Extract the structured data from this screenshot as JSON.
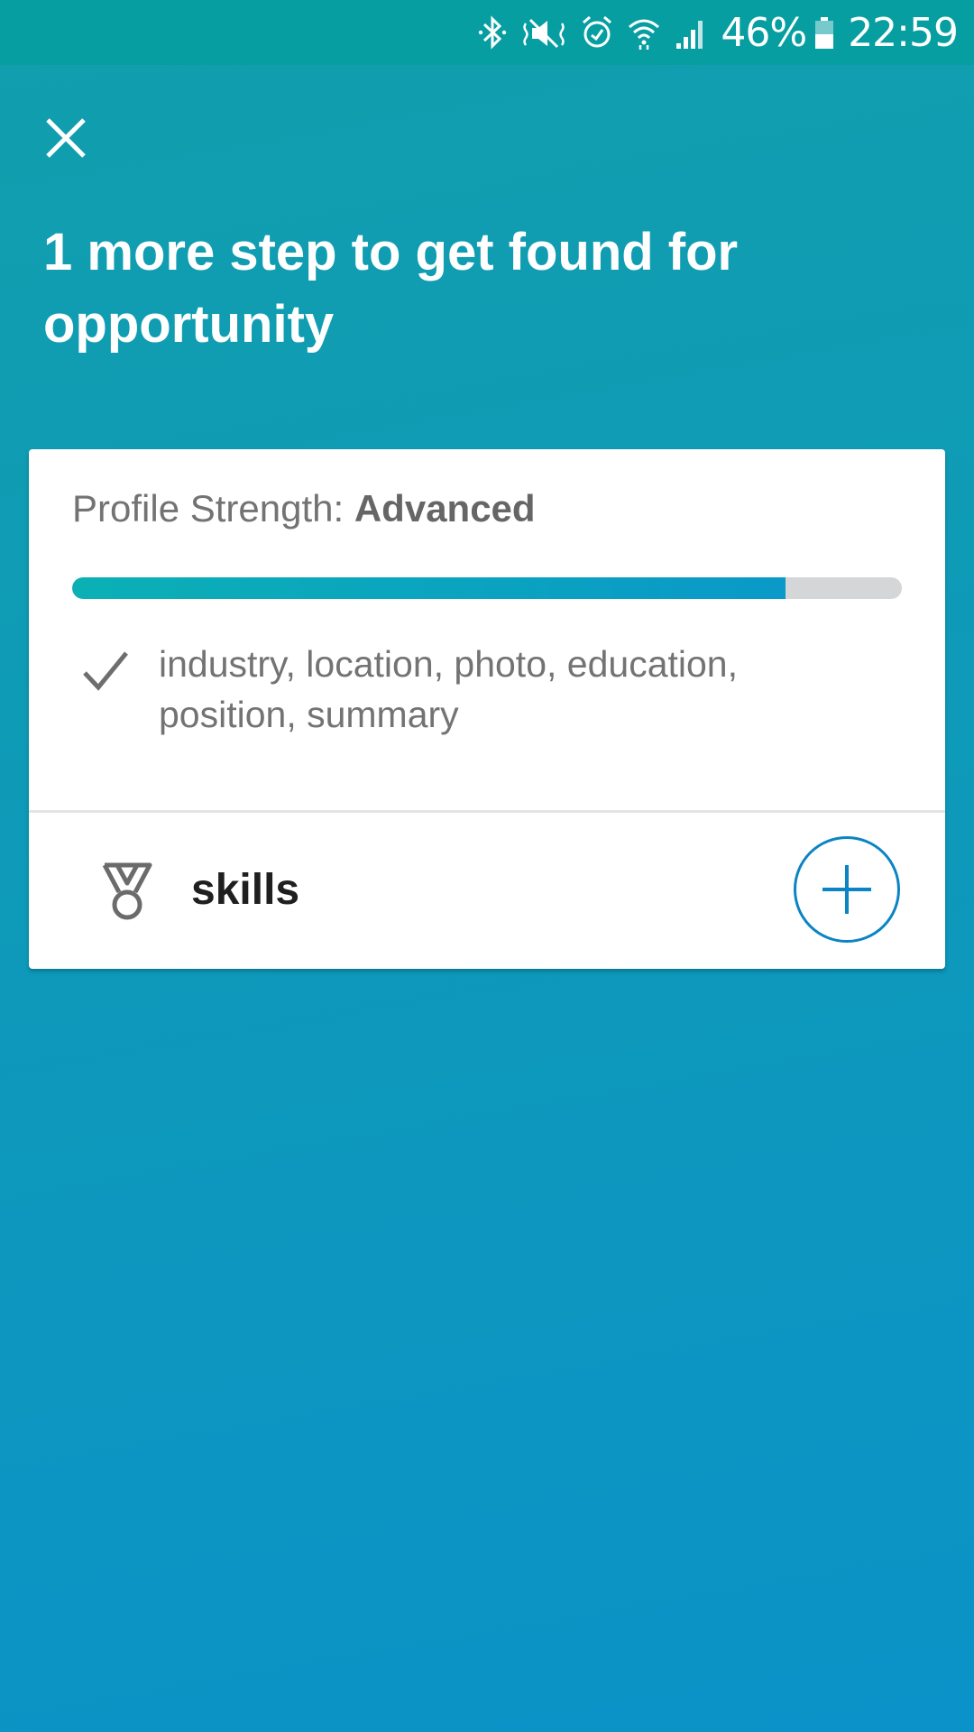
{
  "status_bar": {
    "battery": "46%",
    "time": "22:59",
    "icons": [
      "bluetooth-icon",
      "vibrate-mute-icon",
      "alarm-icon",
      "wifi-icon",
      "signal-icon",
      "battery-icon"
    ]
  },
  "header": {
    "close_icon": "close-icon",
    "headline": "1 more step to get found for opportunity"
  },
  "profile_card": {
    "strength_label": "Profile Strength:",
    "strength_level": "Advanced",
    "progress_fraction": 0.86,
    "completed_items": "industry, location, photo, education, position, summary",
    "missing_item": {
      "icon": "medal-icon",
      "label": "skills",
      "action_icon": "plus-icon"
    }
  },
  "colors": {
    "status_bar": "#079ea2",
    "gradient_top": "#119fad",
    "gradient_bottom": "#0b92c8",
    "accent": "#0b84c4",
    "progress_start": "#0bb0b5",
    "progress_end": "#0a99c8",
    "progress_track": "#d4d6d8"
  }
}
